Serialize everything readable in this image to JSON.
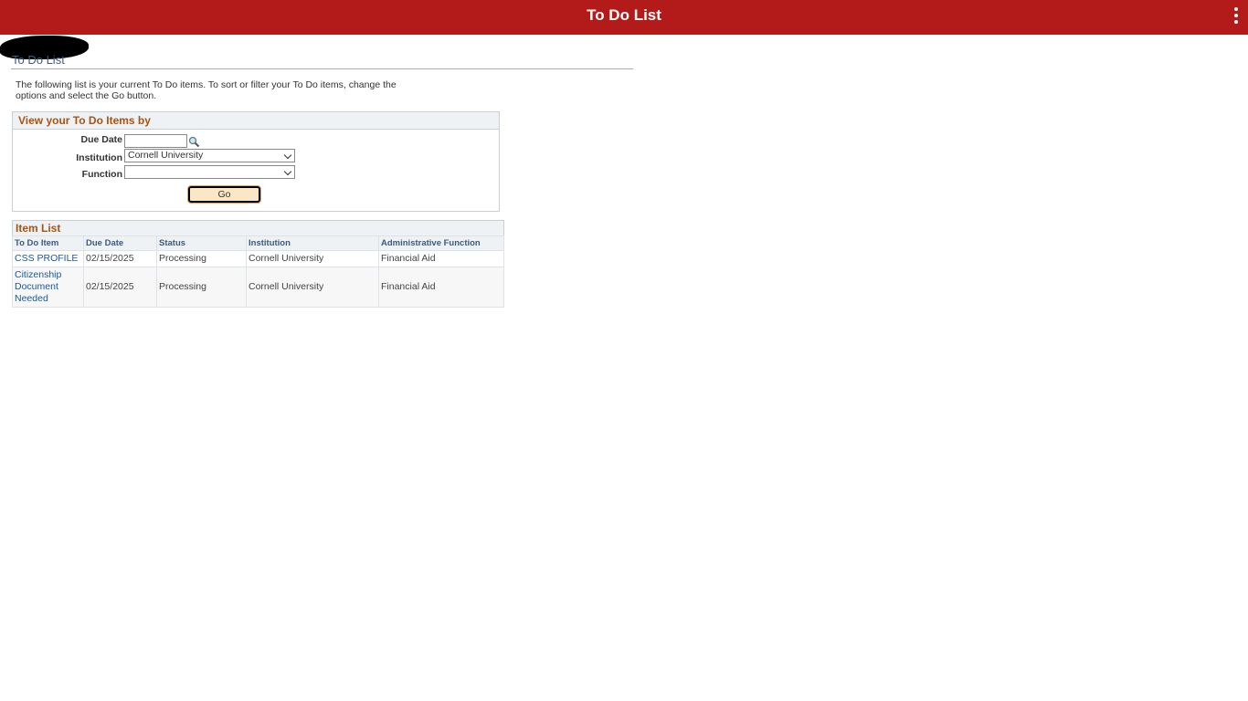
{
  "header": {
    "title": "To Do List",
    "menu_icon": "kebab-menu-icon"
  },
  "breadcrumb": "To Do List",
  "intro": "The following list is your current To Do items. To sort or filter your To Do items, change the options and select the Go button.",
  "filter": {
    "title": "View your To Do Items by",
    "due_date_label": "Due Date",
    "due_date_value": "",
    "institution_label": "Institution",
    "institution_value": "Cornell University",
    "function_label": "Function",
    "function_value": "",
    "go_label": "Go"
  },
  "item_list": {
    "title": "Item List",
    "columns": [
      "To Do Item",
      "Due Date",
      "Status",
      "Institution",
      "Administrative Function"
    ],
    "rows": [
      {
        "item": "CSS PROFILE",
        "due": "02/15/2025",
        "status": "Processing",
        "institution": "Cornell University",
        "function": "Financial Aid"
      },
      {
        "item": "Citizenship Document Needed",
        "due": "02/15/2025",
        "status": "Processing",
        "institution": "Cornell University",
        "function": "Financial Aid"
      }
    ]
  }
}
